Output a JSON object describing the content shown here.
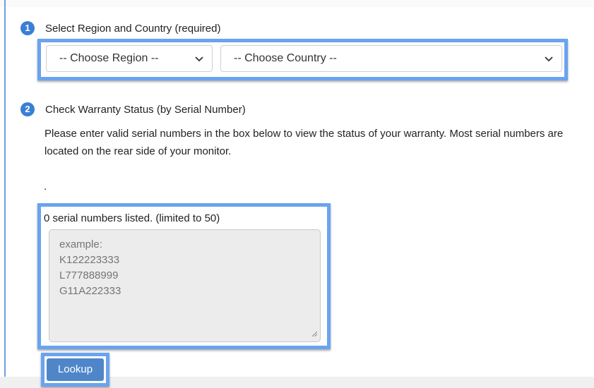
{
  "steps": [
    {
      "number": "1",
      "title": "Select Region and Country (required)"
    },
    {
      "number": "2",
      "title": "Check Warranty Status (by Serial Number)"
    }
  ],
  "region_select": {
    "value": "-- Choose Region --"
  },
  "country_select": {
    "value": "-- Choose Country --"
  },
  "warranty": {
    "description": "Please enter valid serial numbers in the box below to view the status of your warranty. Most serial numbers are located on the rear side of your monitor.",
    "dot": ".",
    "count_text": "0 serial numbers listed. (limited to 50)",
    "placeholder": "example:\nK122223333\nL777888999\nG11A222333"
  },
  "lookup_button": {
    "label": "Lookup"
  },
  "colors": {
    "accent_blue": "#3a7fd5",
    "highlight_border": "#6aa3ef",
    "button_blue": "#4f86c9"
  },
  "icons": {
    "dropdown": "chevron-down-icon",
    "resize": "resize-grip-icon"
  }
}
